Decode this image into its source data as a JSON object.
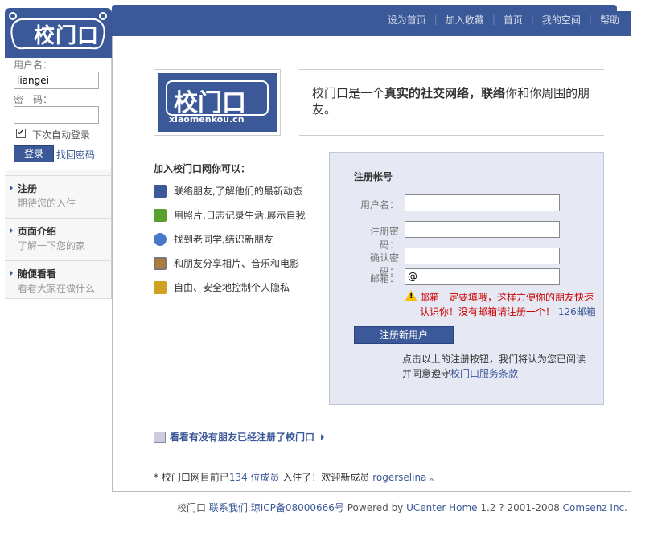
{
  "brand": {
    "logo_text": "校门口",
    "domain_text": "xiaomenkou.cn"
  },
  "topnav": [
    {
      "label": "设为首页"
    },
    {
      "label": "加入收藏"
    },
    {
      "label": "首页"
    },
    {
      "label": "我的空间"
    },
    {
      "label": "帮助"
    }
  ],
  "login": {
    "username_label": "用户名：",
    "username_value": "liangei",
    "password_label": "密　码：",
    "remember_label": "下次自动登录",
    "remember_checked": true,
    "login_button": "登录",
    "forgot_link": "找回密码"
  },
  "sidebar": {
    "items": [
      {
        "title": "注册",
        "subtitle": "期待您的入住"
      },
      {
        "title": "页面介绍",
        "subtitle": "了解一下您的家"
      },
      {
        "title": "随便看看",
        "subtitle": "看看大家在做什么"
      }
    ]
  },
  "intro": {
    "tagline_1": "校门口是一个",
    "tagline_2": "真实的社交网络",
    "tagline_3": "，",
    "tagline_4": "联络",
    "tagline_5": "你和你周围的朋友。"
  },
  "features": {
    "title": "加入校门口网你可以：",
    "items": [
      {
        "label": "联络朋友,了解他们的最新动态",
        "icon": "people-icon",
        "color": "#3b5998"
      },
      {
        "label": "用照片,日志记录生活,展示自我",
        "icon": "chat-icon",
        "color": "#5aa02c"
      },
      {
        "label": "找到老同学,结识新朋友",
        "icon": "person-icon",
        "color": "#4a78c8"
      },
      {
        "label": "和朋友分享相片、音乐和电影",
        "icon": "photo-icon",
        "color": "#b07a3a"
      },
      {
        "label": "自由、安全地控制个人隐私",
        "icon": "privacy-icon",
        "color": "#d0a020"
      }
    ]
  },
  "register": {
    "title": "注册帐号",
    "username_label": "用户名：",
    "password_label": "注册密码：",
    "confirm_label": "确认密码：",
    "email_label": "邮箱：",
    "email_value": "@",
    "warning_text": "邮箱一定要填哦，这样方便你的朋友快速认识你！没有邮箱请注册一个！",
    "warning_link": "126邮箱",
    "submit_button": "注册新用户",
    "terms_text": "点击以上的注册按钮，我们将认为您已阅读并同意遵守",
    "terms_link": "校门口服务条款"
  },
  "friends_link": "看看有没有朋友已经注册了校门口",
  "stats": {
    "prefix": "* 校门口网目前已",
    "count_link": "134 位成员",
    "middle": " 入住了！欢迎新成员 ",
    "new_member": "rogerselina",
    "suffix": " 。"
  },
  "footer": {
    "brand": "校门口",
    "contact": "联系我们",
    "icp": "琼ICP备08000666号",
    "powered": " Powered by ",
    "ucenter": "UCenter Home",
    "version": " 1.2 ? 2001-2008 ",
    "comsenz": "Comsenz Inc."
  }
}
